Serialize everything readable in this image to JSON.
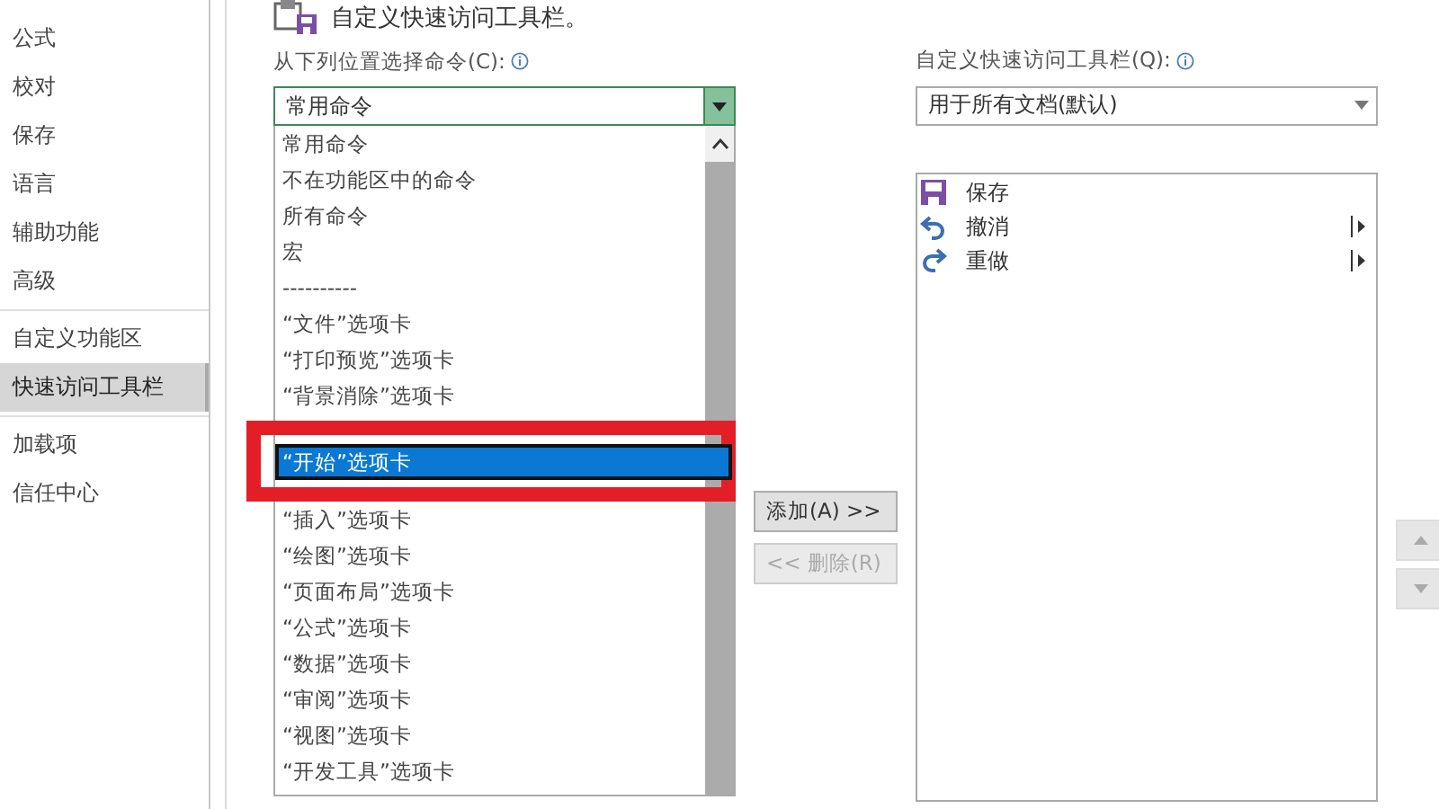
{
  "sidebar": {
    "groups": [
      [
        {
          "label": "公式",
          "selected": false
        },
        {
          "label": "校对",
          "selected": false
        },
        {
          "label": "保存",
          "selected": false
        },
        {
          "label": "语言",
          "selected": false
        },
        {
          "label": "辅助功能",
          "selected": false
        },
        {
          "label": "高级",
          "selected": false
        }
      ],
      [
        {
          "label": "自定义功能区",
          "selected": false
        },
        {
          "label": "快速访问工具栏",
          "selected": true
        }
      ],
      [
        {
          "label": "加载项",
          "selected": false
        },
        {
          "label": "信任中心",
          "selected": false
        }
      ]
    ]
  },
  "header": {
    "title": "自定义快速访问工具栏。"
  },
  "choose_commands": {
    "label": "从下列位置选择命令(C):",
    "dropdown": {
      "value": "常用命令",
      "open": true
    },
    "list": {
      "items": [
        {
          "label": "常用命令",
          "selected": false,
          "highlighted": false
        },
        {
          "label": "不在功能区中的命令",
          "selected": false,
          "highlighted": false
        },
        {
          "label": "所有命令",
          "selected": false,
          "highlighted": false
        },
        {
          "label": "宏",
          "selected": false,
          "highlighted": false
        },
        {
          "label": "----------",
          "selected": false,
          "highlighted": false
        },
        {
          "label": "“文件”选项卡",
          "selected": false,
          "highlighted": false
        },
        {
          "label": "“打印预览”选项卡",
          "selected": false,
          "highlighted": false
        },
        {
          "label": "“背景消除”选项卡",
          "selected": false,
          "highlighted": false
        },
        {
          "label": "“开始”选项卡",
          "selected": true,
          "highlighted": true
        },
        {
          "label": "“插入”选项卡",
          "selected": false,
          "highlighted": false
        },
        {
          "label": "“绘图”选项卡",
          "selected": false,
          "highlighted": false
        },
        {
          "label": "“页面布局”选项卡",
          "selected": false,
          "highlighted": false
        },
        {
          "label": "“公式”选项卡",
          "selected": false,
          "highlighted": false
        },
        {
          "label": "“数据”选项卡",
          "selected": false,
          "highlighted": false
        },
        {
          "label": "“审阅”选项卡",
          "selected": false,
          "highlighted": false
        },
        {
          "label": "“视图”选项卡",
          "selected": false,
          "highlighted": false
        },
        {
          "label": "“开发工具”选项卡",
          "selected": false,
          "highlighted": false
        }
      ]
    }
  },
  "buttons": [
    {
      "label": "添加(A) >>",
      "disabled": false
    },
    {
      "label": "<< 删除(R)",
      "disabled": true
    }
  ],
  "customize_toolbar": {
    "label": "自定义快速访问工具栏(Q):",
    "dropdown": {
      "value": "用于所有文档(默认)"
    },
    "list": {
      "items": [
        {
          "label": "保存",
          "kind": "save",
          "submenu": false
        },
        {
          "label": "撤消",
          "kind": "undo",
          "submenu": true
        },
        {
          "label": "重做",
          "kind": "redo",
          "submenu": true
        }
      ]
    }
  },
  "move_buttons": [
    {
      "kind": "up"
    },
    {
      "kind": "down"
    }
  ]
}
